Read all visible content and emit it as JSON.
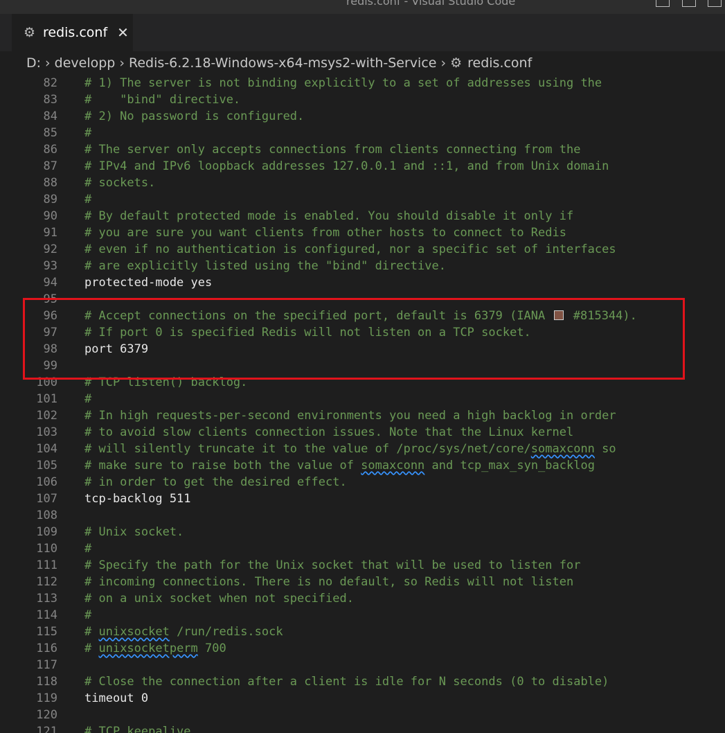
{
  "window": {
    "title": "redis.conf - Visual Studio Code"
  },
  "tab": {
    "label": "redis.conf",
    "close_glyph": "✕",
    "icon": "gear-icon"
  },
  "breadcrumb": {
    "drive": "D:",
    "folder1": "developp",
    "folder2": "Redis-6.2.18-Windows-x64-msys2-with-Service",
    "file": "redis.conf",
    "separator": "›"
  },
  "colors": {
    "comment": "#6a9955",
    "highlight_box": "#e1131b",
    "color_swatch": "#815344"
  },
  "lines": [
    {
      "n": "82",
      "t": "# 1) The server is not binding explicitly to a set of addresses using the"
    },
    {
      "n": "83",
      "t": "#    \"bind\" directive."
    },
    {
      "n": "84",
      "t": "# 2) No password is configured."
    },
    {
      "n": "85",
      "t": "#"
    },
    {
      "n": "86",
      "t": "# The server only accepts connections from clients connecting from the"
    },
    {
      "n": "87",
      "t": "# IPv4 and IPv6 loopback addresses 127.0.0.1 and ::1, and from Unix domain"
    },
    {
      "n": "88",
      "t": "# sockets."
    },
    {
      "n": "89",
      "t": "#"
    },
    {
      "n": "90",
      "t": "# By default protected mode is enabled. You should disable it only if"
    },
    {
      "n": "91",
      "t": "# you are sure you want clients from other hosts to connect to Redis"
    },
    {
      "n": "92",
      "t": "# even if no authentication is configured, nor a specific set of interfaces"
    },
    {
      "n": "93",
      "t": "# are explicitly listed using the \"bind\" directive."
    },
    {
      "n": "94",
      "t": "protected-mode yes"
    },
    {
      "n": "95",
      "t": ""
    },
    {
      "n": "96",
      "t": "# Accept connections on the specified port, default is 6379 (IANA ",
      "t2": " #815344).",
      "swatch": true
    },
    {
      "n": "97",
      "t": "# If port 0 is specified Redis will not listen on a TCP socket."
    },
    {
      "n": "98",
      "t": "port 6379"
    },
    {
      "n": "99",
      "t": ""
    },
    {
      "n": "100",
      "t": "# TCP listen() backlog."
    },
    {
      "n": "101",
      "t": "#"
    },
    {
      "n": "102",
      "t": "# In high requests-per-second environments you need a high backlog in order"
    },
    {
      "n": "103",
      "t": "# to avoid slow clients connection issues. Note that the Linux kernel"
    },
    {
      "n": "104",
      "t": "# will silently truncate it to the value of /proc/sys/net/core/",
      "sq": "somaxconn",
      "t2": " so"
    },
    {
      "n": "105",
      "t": "# make sure to raise both the value of ",
      "sq": "somaxconn",
      "t2": " and tcp_max_syn_backlog"
    },
    {
      "n": "106",
      "t": "# in order to get the desired effect."
    },
    {
      "n": "107",
      "t": "tcp-backlog 511"
    },
    {
      "n": "108",
      "t": ""
    },
    {
      "n": "109",
      "t": "# Unix socket."
    },
    {
      "n": "110",
      "t": "#"
    },
    {
      "n": "111",
      "t": "# Specify the path for the Unix socket that will be used to listen for"
    },
    {
      "n": "112",
      "t": "# incoming connections. There is no default, so Redis will not listen"
    },
    {
      "n": "113",
      "t": "# on a unix socket when not specified."
    },
    {
      "n": "114",
      "t": "#"
    },
    {
      "n": "115",
      "t": "# ",
      "sq": "unixsocket",
      "t2": " /run/redis.sock"
    },
    {
      "n": "116",
      "t": "# ",
      "sq": "unixsocketperm",
      "t2": " 700"
    },
    {
      "n": "117",
      "t": ""
    },
    {
      "n": "118",
      "t": "# Close the connection after a client is idle for N seconds (0 to disable)"
    },
    {
      "n": "119",
      "t": "timeout 0"
    },
    {
      "n": "120",
      "t": ""
    },
    {
      "n": "121",
      "t": "# TCP keepalive."
    }
  ]
}
